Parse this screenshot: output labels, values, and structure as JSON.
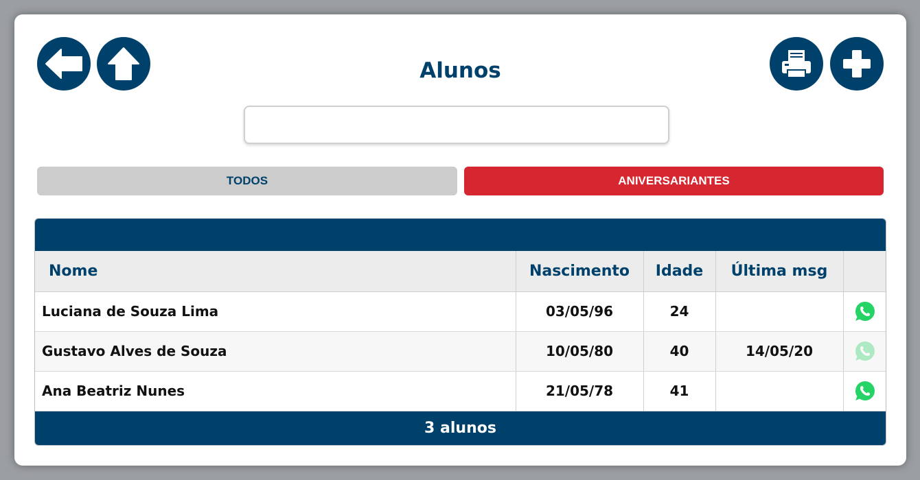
{
  "page": {
    "title": "Alunos",
    "search": {
      "value": "",
      "placeholder": ""
    }
  },
  "toolbar": {
    "back_icon": "arrow-left-icon",
    "home_icon": "arrow-up-icon",
    "print_icon": "printer-icon",
    "add_icon": "plus-icon"
  },
  "tabs": [
    {
      "label": "TODOS",
      "active": false
    },
    {
      "label": "ANIVERSARIANTES",
      "active": true
    }
  ],
  "table": {
    "columns": [
      "Nome",
      "Nascimento",
      "Idade",
      "Última msg",
      ""
    ],
    "rows": [
      {
        "nome": "Luciana de Souza Lima",
        "nascimento": "03/05/96",
        "idade": "24",
        "ultima_msg": "",
        "whatsapp_active": true
      },
      {
        "nome": "Gustavo Alves de Souza",
        "nascimento": "10/05/80",
        "idade": "40",
        "ultima_msg": "14/05/20",
        "whatsapp_active": false
      },
      {
        "nome": "Ana Beatriz Nunes",
        "nascimento": "21/05/78",
        "idade": "41",
        "ultima_msg": "",
        "whatsapp_active": true
      }
    ],
    "footer": "3 alunos"
  },
  "colors": {
    "primary": "#00416b",
    "danger": "#d62630",
    "tab_inactive": "#cccccc",
    "whatsapp": "#25d366"
  }
}
